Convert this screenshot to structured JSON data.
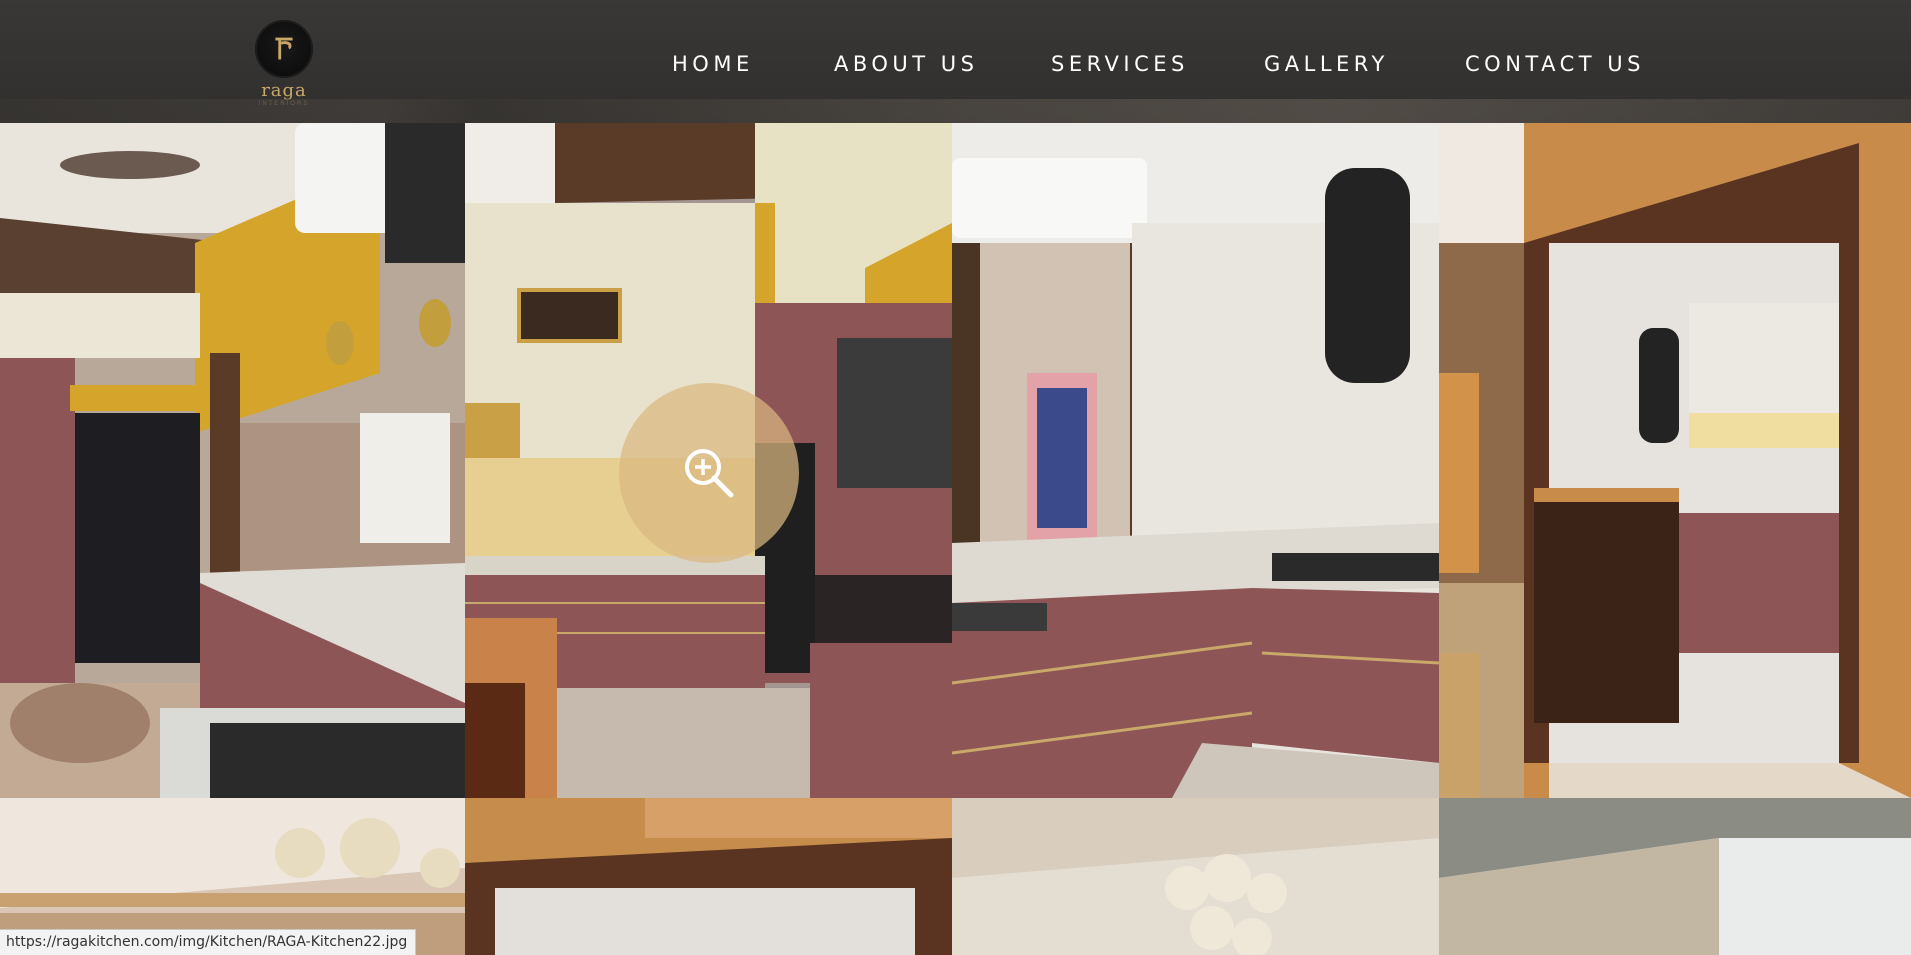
{
  "brand": {
    "logo_letter": "r",
    "name": "raga",
    "tagline": "INTERIORS"
  },
  "nav": {
    "items": [
      {
        "label": "HOME"
      },
      {
        "label": "ABOUT US"
      },
      {
        "label": "SERVICES"
      },
      {
        "label": "GALLERY"
      },
      {
        "label": "CONTACT US"
      }
    ]
  },
  "gallery": {
    "hover_icon": "zoom-in-icon",
    "images": [
      "kitchen-island-with-ceiling-fan",
      "cream-cabinets-with-pink-lower-units",
      "black-chimney-hood-with-pink-cabinets",
      "wooden-frame-kitchen-partition",
      "gold-pendant-lights-ceiling",
      "wooden-frame-doorway-ceiling",
      "glass-globe-chandelier",
      "white-ceiling-with-spotlights"
    ]
  },
  "status_bar": {
    "url": "https://ragakitchen.com/img/Kitchen/RAGA-Kitchen22.jpg"
  },
  "colors": {
    "header_bg": "#343331",
    "nav_text": "#ffffff",
    "brand_gold": "#c9a86a",
    "cabinet_pink": "#8e5557",
    "overlay_tan": "#dab780"
  }
}
